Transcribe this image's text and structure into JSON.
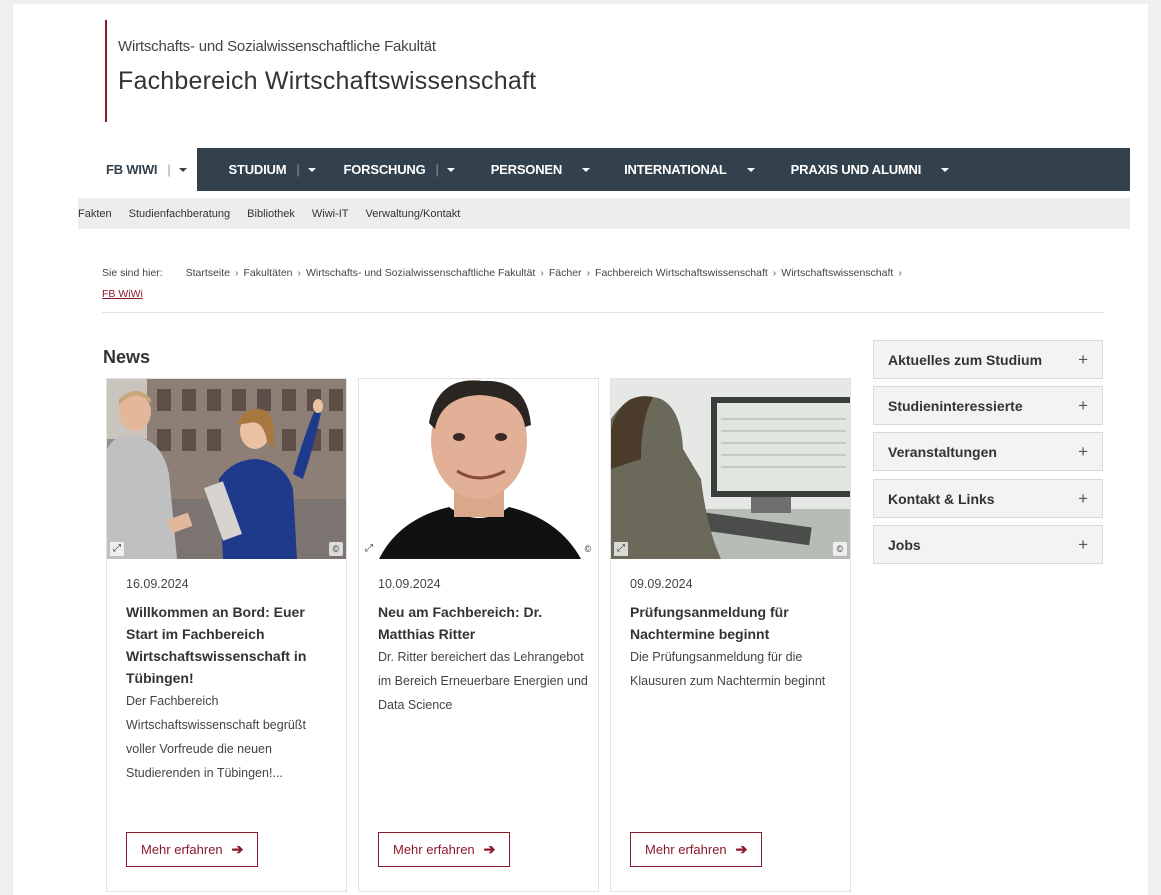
{
  "header": {
    "faculty": "Wirtschafts- und Sozialwissenschaftliche Fakultät",
    "department": "Fachbereich Wirtschaftswissenschaft"
  },
  "mainnav": {
    "items": [
      {
        "label": "FB WIWI",
        "has_separator": true
      },
      {
        "label": "STUDIUM",
        "has_separator": true
      },
      {
        "label": "FORSCHUNG",
        "has_separator": true
      },
      {
        "label": "PERSONEN",
        "has_separator": false
      },
      {
        "label": "INTERNATIONAL",
        "has_separator": false
      },
      {
        "label": "PRAXIS UND ALUMNI",
        "has_separator": false
      }
    ]
  },
  "subnav": {
    "items": [
      "Fakten",
      "Studienfachberatung",
      "Bibliothek",
      "Wiwi-IT",
      "Verwaltung/Kontakt"
    ]
  },
  "breadcrumb": {
    "lead": "Sie sind hier:",
    "crumbs": [
      "Startseite",
      "Fakultäten",
      "Wirtschafts- und Sozialwissenschaftliche Fakultät",
      "Fächer",
      "Fachbereich Wirtschaftswissenschaft",
      "Wirtschaftswissenschaft"
    ],
    "current": "FB WiWi",
    "separator": "›"
  },
  "news": {
    "title": "News",
    "cards": [
      {
        "date": "16.09.2024",
        "headline": "Willkommen an Bord: Euer Start im Fachbereich Wirtschaftswissenschaft in Tübingen!",
        "teaser": "Der Fachbereich Wirtschaftswissenschaft begrüßt voller Vorfreude die neuen Studierenden in Tübingen!...",
        "button": "Mehr erfahren"
      },
      {
        "date": "10.09.2024",
        "headline": "Neu am Fachbereich: Dr. Matthias Ritter",
        "teaser": "Dr. Ritter bereichert das Lehrangebot im Bereich Erneuerbare Energien und Data Science",
        "button": "Mehr erfahren"
      },
      {
        "date": "09.09.2024",
        "headline": "Prüfungsanmeldung für Nachtermine beginnt",
        "teaser": "Die Prüfungsanmeldung für die Klausuren zum Nachtermin beginnt",
        "button": "Mehr erfahren"
      }
    ],
    "image_overlay": {
      "expand": "⤢",
      "copyright": "©"
    }
  },
  "sidebar": {
    "items": [
      "Aktuelles zum Studium",
      "Studieninteressierte",
      "Veranstaltungen",
      "Kontakt & Links",
      "Jobs"
    ],
    "toggle": "+"
  },
  "colors": {
    "accent": "#8b1a2b",
    "nav_bg": "#32414b",
    "subnav_bg": "#ededed"
  }
}
